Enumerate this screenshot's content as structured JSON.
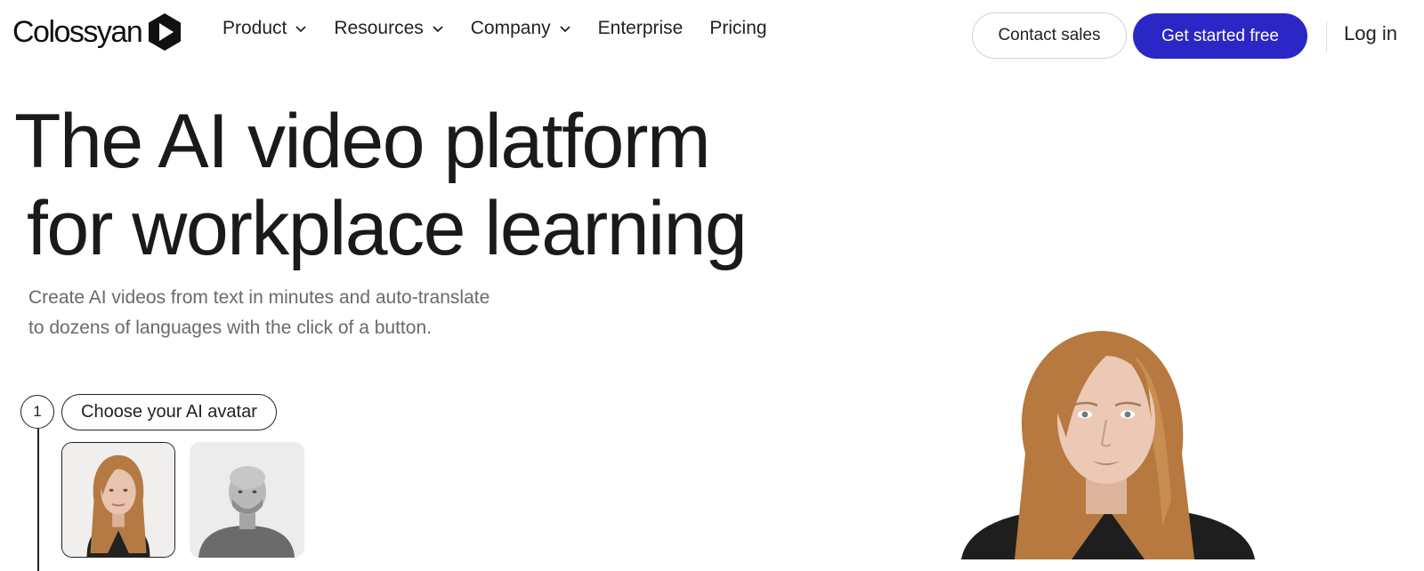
{
  "brand": {
    "name": "Colossyan",
    "accent": "#2b27c6"
  },
  "nav": {
    "items": [
      {
        "label": "Product",
        "has_dropdown": true
      },
      {
        "label": "Resources",
        "has_dropdown": true
      },
      {
        "label": "Company",
        "has_dropdown": true
      },
      {
        "label": "Enterprise",
        "has_dropdown": false
      },
      {
        "label": "Pricing",
        "has_dropdown": false
      }
    ],
    "contact_label": "Contact sales",
    "cta_label": "Get started free",
    "login_label": "Log in"
  },
  "hero": {
    "title_line1": "The AI video platform",
    "title_line2": "for workplace learning",
    "subtitle_line1": "Create AI videos from text in minutes and auto-translate",
    "subtitle_line2": "to dozens of languages with the click of a button."
  },
  "steps": [
    {
      "number": "1",
      "label": "Choose your AI avatar"
    }
  ],
  "avatars": [
    {
      "name": "female-presenter",
      "selected": true
    },
    {
      "name": "male-presenter",
      "selected": false
    }
  ],
  "icons": {
    "logo": "play-hexagon-icon",
    "dropdown": "chevron-down-icon"
  }
}
